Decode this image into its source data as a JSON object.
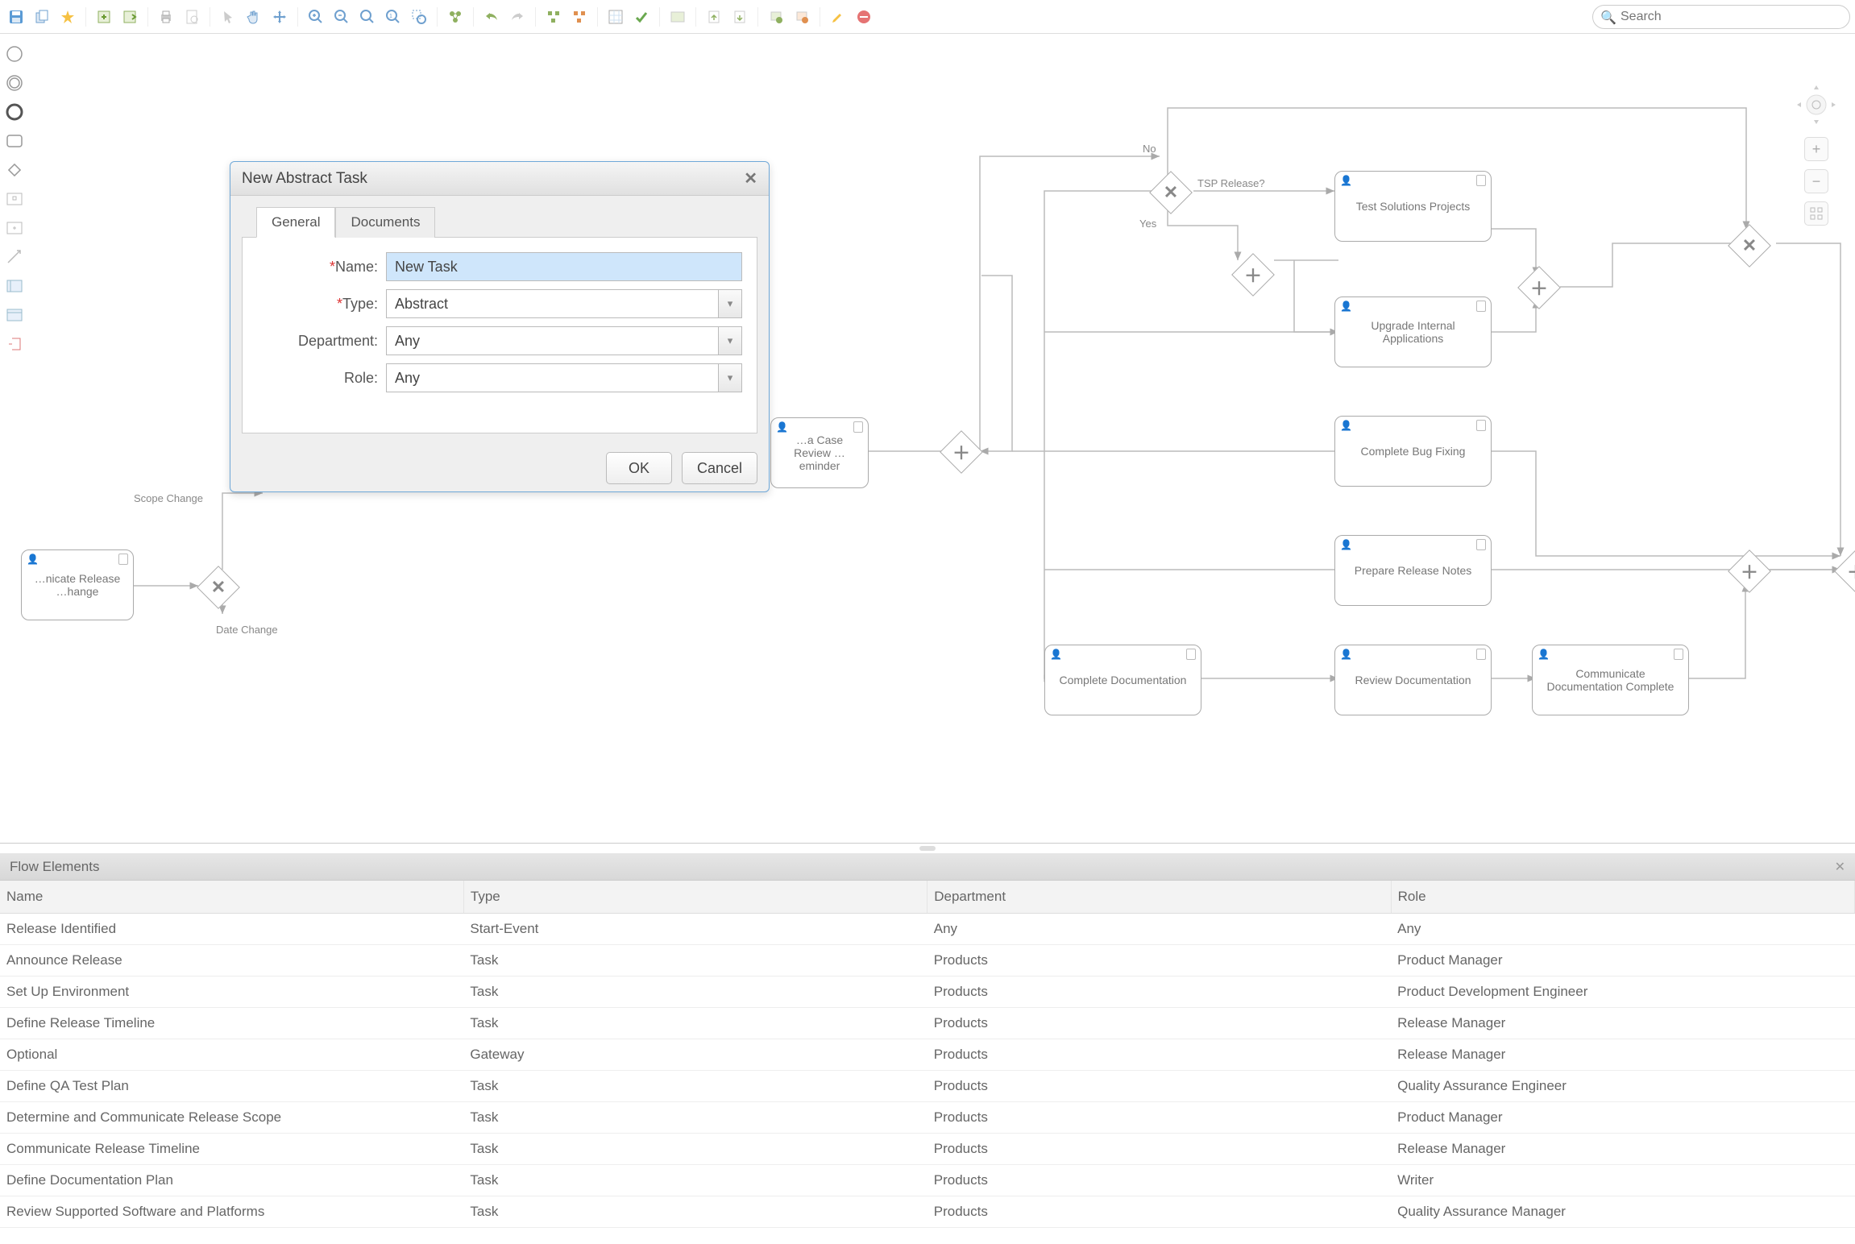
{
  "search": {
    "placeholder": "Search"
  },
  "dialog": {
    "title": "New Abstract Task",
    "tabs": {
      "general": "General",
      "documents": "Documents"
    },
    "labels": {
      "name": "Name:",
      "type": "Type:",
      "department": "Department:",
      "role": "Role:"
    },
    "values": {
      "name": "New Task",
      "type": "Abstract",
      "department": "Any",
      "role": "Any"
    },
    "actions": {
      "ok": "OK",
      "cancel": "Cancel"
    }
  },
  "canvas": {
    "labels": {
      "scope_change": "Scope Change",
      "date_change": "Date Change",
      "no": "No",
      "yes": "Yes",
      "tsp_release": "TSP Release?"
    },
    "tasks": {
      "communicate_release_change": "…nicate Release …hange",
      "case_review_reminder": "…a Case Review …eminder",
      "test_solutions_projects": "Test Solutions Projects",
      "upgrade_internal_applications": "Upgrade Internal Applications",
      "complete_bug_fixing": "Complete Bug Fixing",
      "prepare_release_notes": "Prepare Release Notes",
      "complete_documentation": "Complete Documentation",
      "review_documentation": "Review Documentation",
      "communicate_documentation_complete": "Communicate Documentation Complete"
    }
  },
  "bottom": {
    "title": "Flow Elements",
    "columns": {
      "name": "Name",
      "type": "Type",
      "department": "Department",
      "role": "Role"
    },
    "rows": [
      {
        "name": "Release Identified",
        "type": "Start-Event",
        "department": "Any",
        "role": "Any"
      },
      {
        "name": "Announce Release",
        "type": "Task",
        "department": "Products",
        "role": "Product Manager"
      },
      {
        "name": "Set Up Environment",
        "type": "Task",
        "department": "Products",
        "role": "Product Development Engineer"
      },
      {
        "name": "Define Release Timeline",
        "type": "Task",
        "department": "Products",
        "role": "Release Manager"
      },
      {
        "name": "Optional",
        "type": "Gateway",
        "department": "Products",
        "role": "Release Manager"
      },
      {
        "name": "Define QA Test Plan",
        "type": "Task",
        "department": "Products",
        "role": "Quality Assurance Engineer"
      },
      {
        "name": "Determine and Communicate Release Scope",
        "type": "Task",
        "department": "Products",
        "role": "Product Manager"
      },
      {
        "name": "Communicate Release Timeline",
        "type": "Task",
        "department": "Products",
        "role": "Release Manager"
      },
      {
        "name": "Define Documentation Plan",
        "type": "Task",
        "department": "Products",
        "role": "Writer"
      },
      {
        "name": "Review Supported Software and Platforms",
        "type": "Task",
        "department": "Products",
        "role": "Quality Assurance Manager"
      }
    ]
  }
}
